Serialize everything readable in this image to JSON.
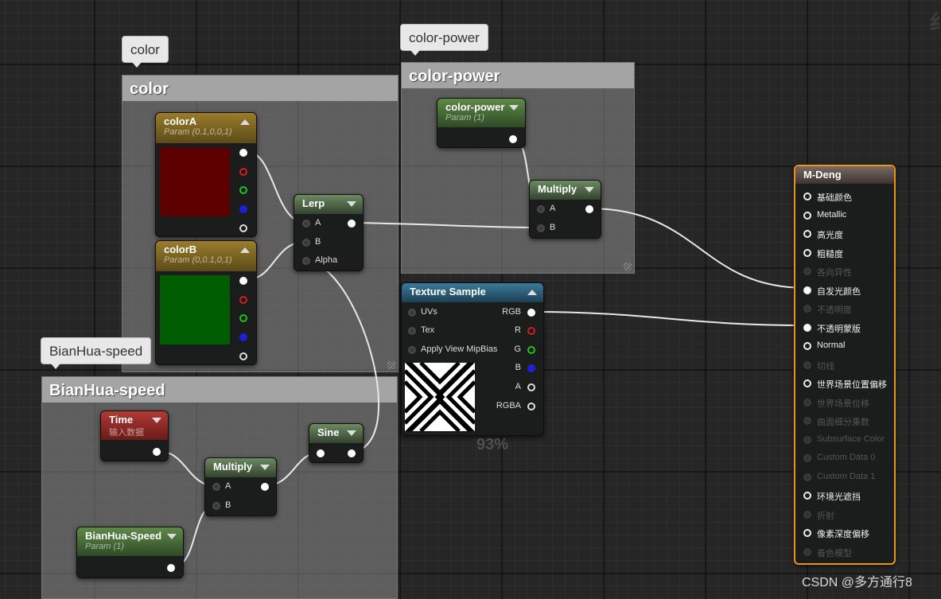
{
  "corner_char": "纟",
  "watermark": "CSDN @多方通行8",
  "zoom_percent": "93%",
  "groups": {
    "color": {
      "bubble": "color",
      "title": "color"
    },
    "power": {
      "bubble": "color-power",
      "title": "color-power"
    },
    "speed": {
      "bubble": "BianHua-speed",
      "title": "BianHua-speed"
    }
  },
  "nodes": {
    "colorA": {
      "title": "colorA",
      "sub": "Param (0.1,0,0,1)",
      "swatch": "#5c0000"
    },
    "colorB": {
      "title": "colorB",
      "sub": "Param (0,0.1,0,1)",
      "swatch": "#005c00"
    },
    "lerp": {
      "title": "Lerp",
      "inputs": [
        "A",
        "B",
        "Alpha"
      ]
    },
    "colorPower": {
      "title": "color-power",
      "sub": "Param (1)"
    },
    "multiplyPower": {
      "title": "Multiply",
      "inputs": [
        "A",
        "B"
      ]
    },
    "texture": {
      "title": "Texture Sample",
      "inputs": [
        "UVs",
        "Tex",
        "Apply View MipBias"
      ],
      "outputs": [
        "RGB",
        "R",
        "G",
        "B",
        "A",
        "RGBA"
      ]
    },
    "time": {
      "title": "Time",
      "sub": "输入数据"
    },
    "multiplySpeed": {
      "title": "Multiply",
      "inputs": [
        "A",
        "B"
      ]
    },
    "sine": {
      "title": "Sine"
    },
    "speedParam": {
      "title": "BianHua-Speed",
      "sub": "Param (1)"
    },
    "material": {
      "title": "M-Deng",
      "pins": [
        {
          "label": "基础颜色",
          "active": true
        },
        {
          "label": "Metallic",
          "active": true
        },
        {
          "label": "高光度",
          "active": true
        },
        {
          "label": "粗糙度",
          "active": true
        },
        {
          "label": "各向异性",
          "active": false
        },
        {
          "label": "自发光颜色",
          "active": true
        },
        {
          "label": "不透明度",
          "active": false
        },
        {
          "label": "不透明蒙版",
          "active": true
        },
        {
          "label": "Normal",
          "active": true
        },
        {
          "label": "切线",
          "active": false
        },
        {
          "label": "世界场景位置偏移",
          "active": true
        },
        {
          "label": "世界场景位移",
          "active": false
        },
        {
          "label": "曲面细分乘数",
          "active": false
        },
        {
          "label": "Subsurface Color",
          "active": false
        },
        {
          "label": "Custom Data 0",
          "active": false
        },
        {
          "label": "Custom Data 1",
          "active": false
        },
        {
          "label": "环境光遮挡",
          "active": true
        },
        {
          "label": "折射",
          "active": false
        },
        {
          "label": "像素深度偏移",
          "active": true
        },
        {
          "label": "着色模型",
          "active": false
        }
      ]
    }
  }
}
